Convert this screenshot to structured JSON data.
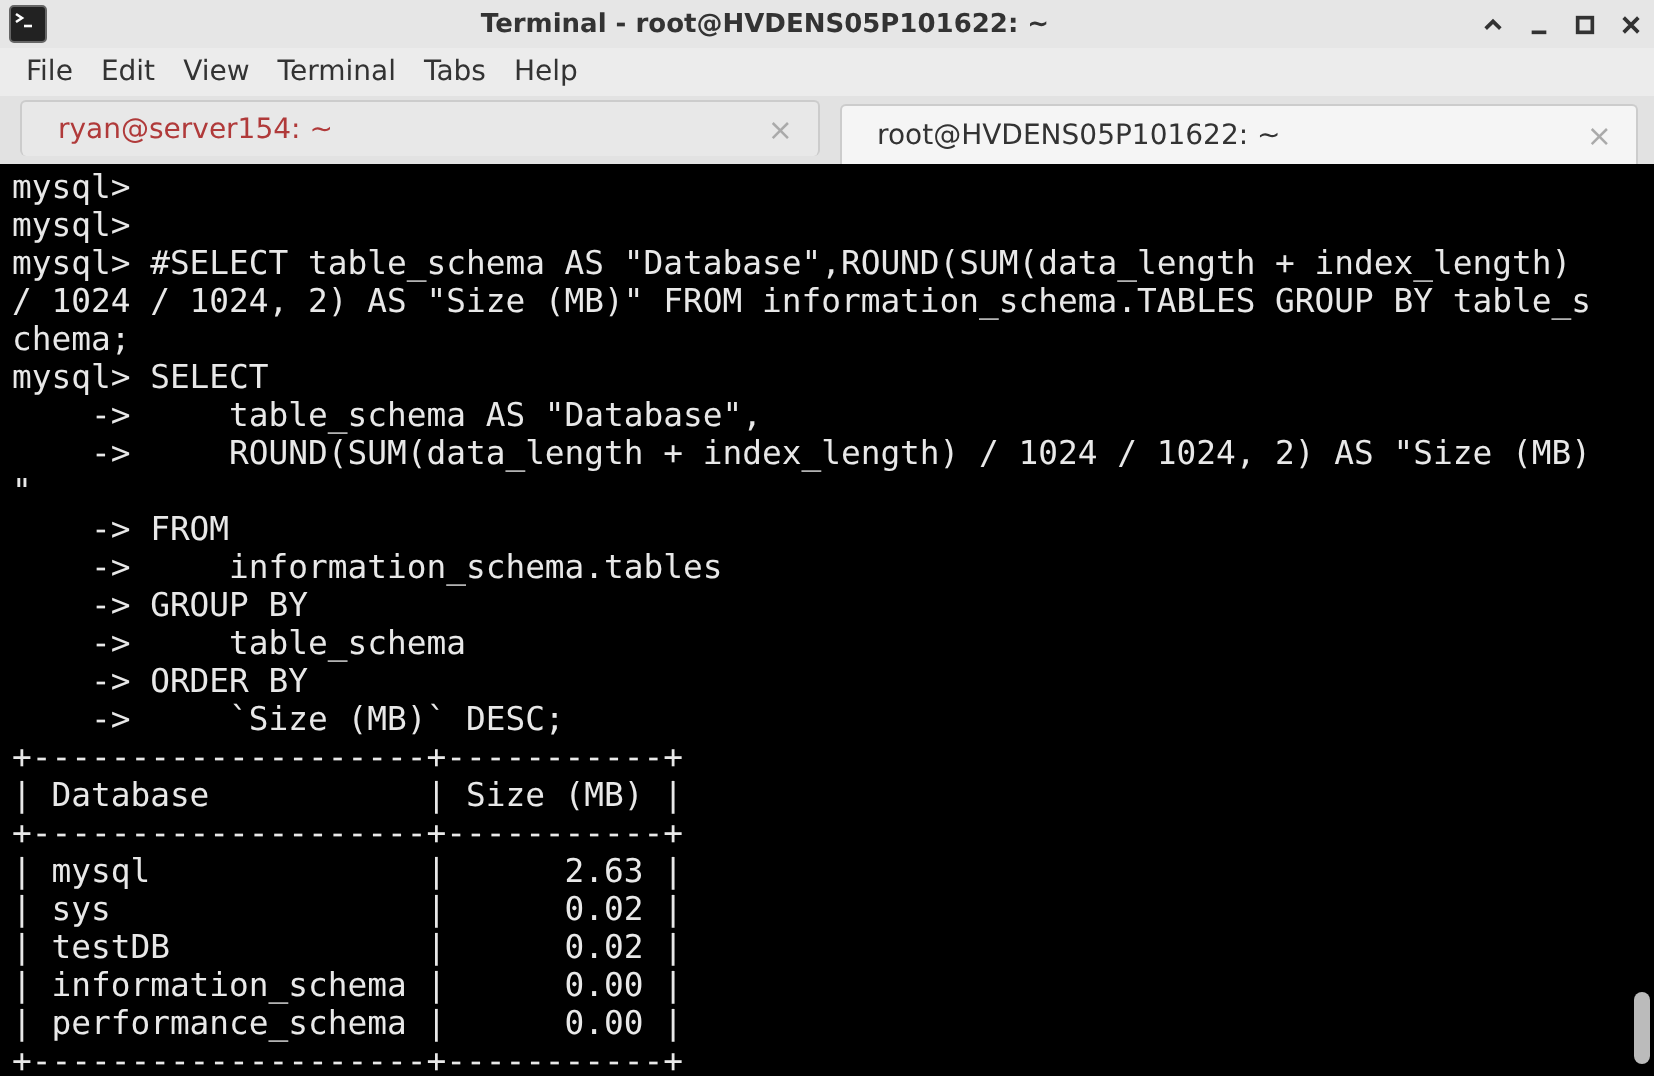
{
  "window": {
    "title": "Terminal - root@HVDENS05P101622: ~"
  },
  "menu": [
    "File",
    "Edit",
    "View",
    "Terminal",
    "Tabs",
    "Help"
  ],
  "tabs": [
    {
      "label": "ryan@server154: ~",
      "selected": false,
      "close": "×"
    },
    {
      "label": "root@HVDENS05P101622: ~",
      "selected": true,
      "close": "×"
    }
  ],
  "terminal": {
    "lines": [
      "mysql>",
      "mysql>",
      "mysql> #SELECT table_schema AS \"Database\",ROUND(SUM(data_length + index_length)",
      "/ 1024 / 1024, 2) AS \"Size (MB)\" FROM information_schema.TABLES GROUP BY table_s",
      "chema;",
      "mysql> SELECT",
      "    ->     table_schema AS \"Database\",",
      "    ->     ROUND(SUM(data_length + index_length) / 1024 / 1024, 2) AS \"Size (MB)",
      "\"",
      "    -> FROM",
      "    ->     information_schema.tables",
      "    -> GROUP BY",
      "    ->     table_schema",
      "    -> ORDER BY",
      "    ->     `Size (MB)` DESC;",
      "+--------------------+-----------+",
      "| Database           | Size (MB) |",
      "+--------------------+-----------+",
      "| mysql              |      2.63 |",
      "| sys                |      0.02 |",
      "| testDB             |      0.02 |",
      "| information_schema |      0.00 |",
      "| performance_schema |      0.00 |",
      "+--------------------+-----------+"
    ]
  }
}
